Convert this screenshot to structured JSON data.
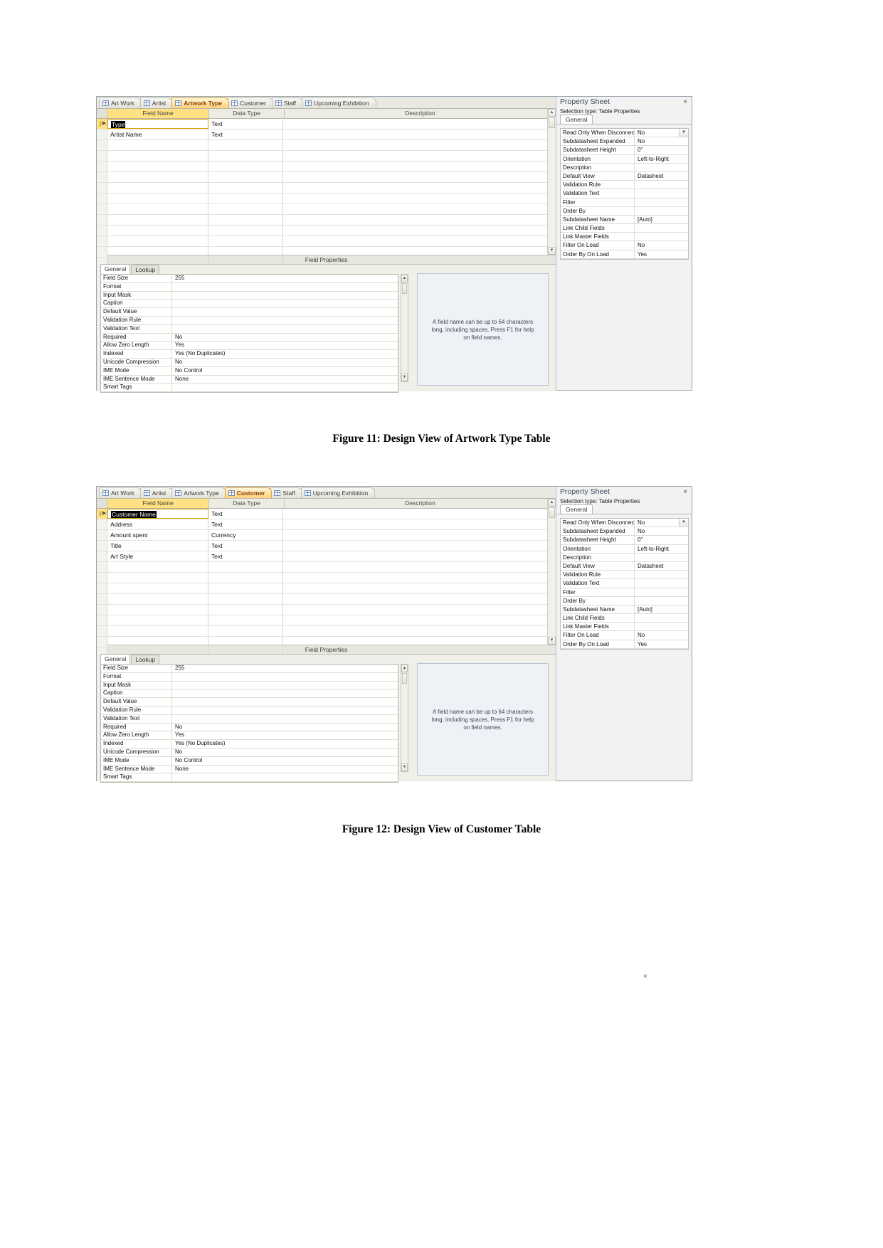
{
  "figures": [
    {
      "id": "fig11",
      "caption": "Figure 11: Design View of Artwork Type Table",
      "tabs": [
        {
          "label": "Art Work",
          "active": false
        },
        {
          "label": "Artist",
          "active": false
        },
        {
          "label": "Artwork Type",
          "active": true
        },
        {
          "label": "Customer",
          "active": false
        },
        {
          "label": "Staff",
          "active": false
        },
        {
          "label": "Upcoming Exhibition",
          "active": false
        }
      ],
      "grid": {
        "headers": {
          "field_name": "Field Name",
          "data_type": "Data Type",
          "description": "Description"
        },
        "rows": [
          {
            "field_name": "Type",
            "data_type": "Text",
            "description": "",
            "primary_key": true,
            "selected": true
          },
          {
            "field_name": "Artist Name",
            "data_type": "Text",
            "description": "",
            "primary_key": false,
            "selected": false
          }
        ],
        "empty_rows": 12
      },
      "field_properties_bar": "Field Properties",
      "field_properties": {
        "tabs": [
          {
            "label": "General",
            "active": true
          },
          {
            "label": "Lookup",
            "active": false
          }
        ],
        "rows": [
          {
            "key": "Field Size",
            "value": "255"
          },
          {
            "key": "Format",
            "value": ""
          },
          {
            "key": "Input Mask",
            "value": ""
          },
          {
            "key": "Caption",
            "value": ""
          },
          {
            "key": "Default Value",
            "value": ""
          },
          {
            "key": "Validation Rule",
            "value": ""
          },
          {
            "key": "Validation Text",
            "value": ""
          },
          {
            "key": "Required",
            "value": "No"
          },
          {
            "key": "Allow Zero Length",
            "value": "Yes"
          },
          {
            "key": "Indexed",
            "value": "Yes (No Duplicates)"
          },
          {
            "key": "Unicode Compression",
            "value": "No"
          },
          {
            "key": "IME Mode",
            "value": "No Control"
          },
          {
            "key": "IME Sentence Mode",
            "value": "None"
          },
          {
            "key": "Smart Tags",
            "value": ""
          }
        ],
        "help_text": "A field name can be up to 64 characters long, including spaces. Press F1 for help on field names."
      },
      "property_sheet": {
        "title": "Property Sheet",
        "selection_type": "Selection type:  Table Properties",
        "tabs": [
          {
            "label": "General",
            "active": true
          }
        ],
        "rows": [
          {
            "key": "Read Only When Disconnected",
            "value": "No"
          },
          {
            "key": "Subdatasheet Expanded",
            "value": "No"
          },
          {
            "key": "Subdatasheet Height",
            "value": "0\""
          },
          {
            "key": "Orientation",
            "value": "Left-to-Right"
          },
          {
            "key": "Description",
            "value": ""
          },
          {
            "key": "Default View",
            "value": "Datasheet"
          },
          {
            "key": "Validation Rule",
            "value": ""
          },
          {
            "key": "Validation Text",
            "value": ""
          },
          {
            "key": "Filter",
            "value": ""
          },
          {
            "key": "Order By",
            "value": ""
          },
          {
            "key": "Subdatasheet Name",
            "value": "[Auto]"
          },
          {
            "key": "Link Child Fields",
            "value": ""
          },
          {
            "key": "Link Master Fields",
            "value": ""
          },
          {
            "key": "Filter On Load",
            "value": "No"
          },
          {
            "key": "Order By On Load",
            "value": "Yes"
          }
        ]
      }
    },
    {
      "id": "fig12",
      "caption": "Figure 12: Design View of Customer Table",
      "tabs": [
        {
          "label": "Art Work",
          "active": false
        },
        {
          "label": "Artist",
          "active": false
        },
        {
          "label": "Artwork Type",
          "active": false
        },
        {
          "label": "Customer",
          "active": true
        },
        {
          "label": "Staff",
          "active": false
        },
        {
          "label": "Upcoming Exhibition",
          "active": false
        }
      ],
      "grid": {
        "headers": {
          "field_name": "Field Name",
          "data_type": "Data Type",
          "description": "Description"
        },
        "rows": [
          {
            "field_name": "Customer Name",
            "data_type": "Text",
            "description": "",
            "primary_key": true,
            "selected": true
          },
          {
            "field_name": "Address",
            "data_type": "Text",
            "description": "",
            "primary_key": false,
            "selected": false
          },
          {
            "field_name": "Amount spent",
            "data_type": "Currency",
            "description": "",
            "primary_key": false,
            "selected": false
          },
          {
            "field_name": "Title",
            "data_type": "Text",
            "description": "",
            "primary_key": false,
            "selected": false
          },
          {
            "field_name": "Art Style",
            "data_type": "Text",
            "description": "",
            "primary_key": false,
            "selected": false
          }
        ],
        "empty_rows": 9
      },
      "field_properties_bar": "Field Properties",
      "field_properties": {
        "tabs": [
          {
            "label": "General",
            "active": true
          },
          {
            "label": "Lookup",
            "active": false
          }
        ],
        "rows": [
          {
            "key": "Field Size",
            "value": "255"
          },
          {
            "key": "Format",
            "value": ""
          },
          {
            "key": "Input Mask",
            "value": ""
          },
          {
            "key": "Caption",
            "value": ""
          },
          {
            "key": "Default Value",
            "value": ""
          },
          {
            "key": "Validation Rule",
            "value": ""
          },
          {
            "key": "Validation Text",
            "value": ""
          },
          {
            "key": "Required",
            "value": "No"
          },
          {
            "key": "Allow Zero Length",
            "value": "Yes"
          },
          {
            "key": "Indexed",
            "value": "Yes (No Duplicates)"
          },
          {
            "key": "Unicode Compression",
            "value": "No"
          },
          {
            "key": "IME Mode",
            "value": "No Control"
          },
          {
            "key": "IME Sentence Mode",
            "value": "None"
          },
          {
            "key": "Smart Tags",
            "value": ""
          }
        ],
        "help_text": "A field name can be up to 64 characters long, including spaces. Press F1 for help on field names."
      },
      "property_sheet": {
        "title": "Property Sheet",
        "selection_type": "Selection type:  Table Properties",
        "tabs": [
          {
            "label": "General",
            "active": true
          }
        ],
        "rows": [
          {
            "key": "Read Only When Disconnected",
            "value": "No"
          },
          {
            "key": "Subdatasheet Expanded",
            "value": "No"
          },
          {
            "key": "Subdatasheet Height",
            "value": "0\""
          },
          {
            "key": "Orientation",
            "value": "Left-to-Right"
          },
          {
            "key": "Description",
            "value": ""
          },
          {
            "key": "Default View",
            "value": "Datasheet"
          },
          {
            "key": "Validation Rule",
            "value": ""
          },
          {
            "key": "Validation Text",
            "value": ""
          },
          {
            "key": "Filter",
            "value": ""
          },
          {
            "key": "Order By",
            "value": ""
          },
          {
            "key": "Subdatasheet Name",
            "value": "[Auto]"
          },
          {
            "key": "Link Child Fields",
            "value": ""
          },
          {
            "key": "Link Master Fields",
            "value": ""
          },
          {
            "key": "Filter On Load",
            "value": "No"
          },
          {
            "key": "Order By On Load",
            "value": "Yes"
          }
        ]
      }
    }
  ],
  "icons": {
    "table": "table-icon",
    "close": "×",
    "key": "⚷",
    "arrow": "▶",
    "scroll_up": "▲",
    "scroll_down": "▼",
    "dropdown": "▼"
  }
}
